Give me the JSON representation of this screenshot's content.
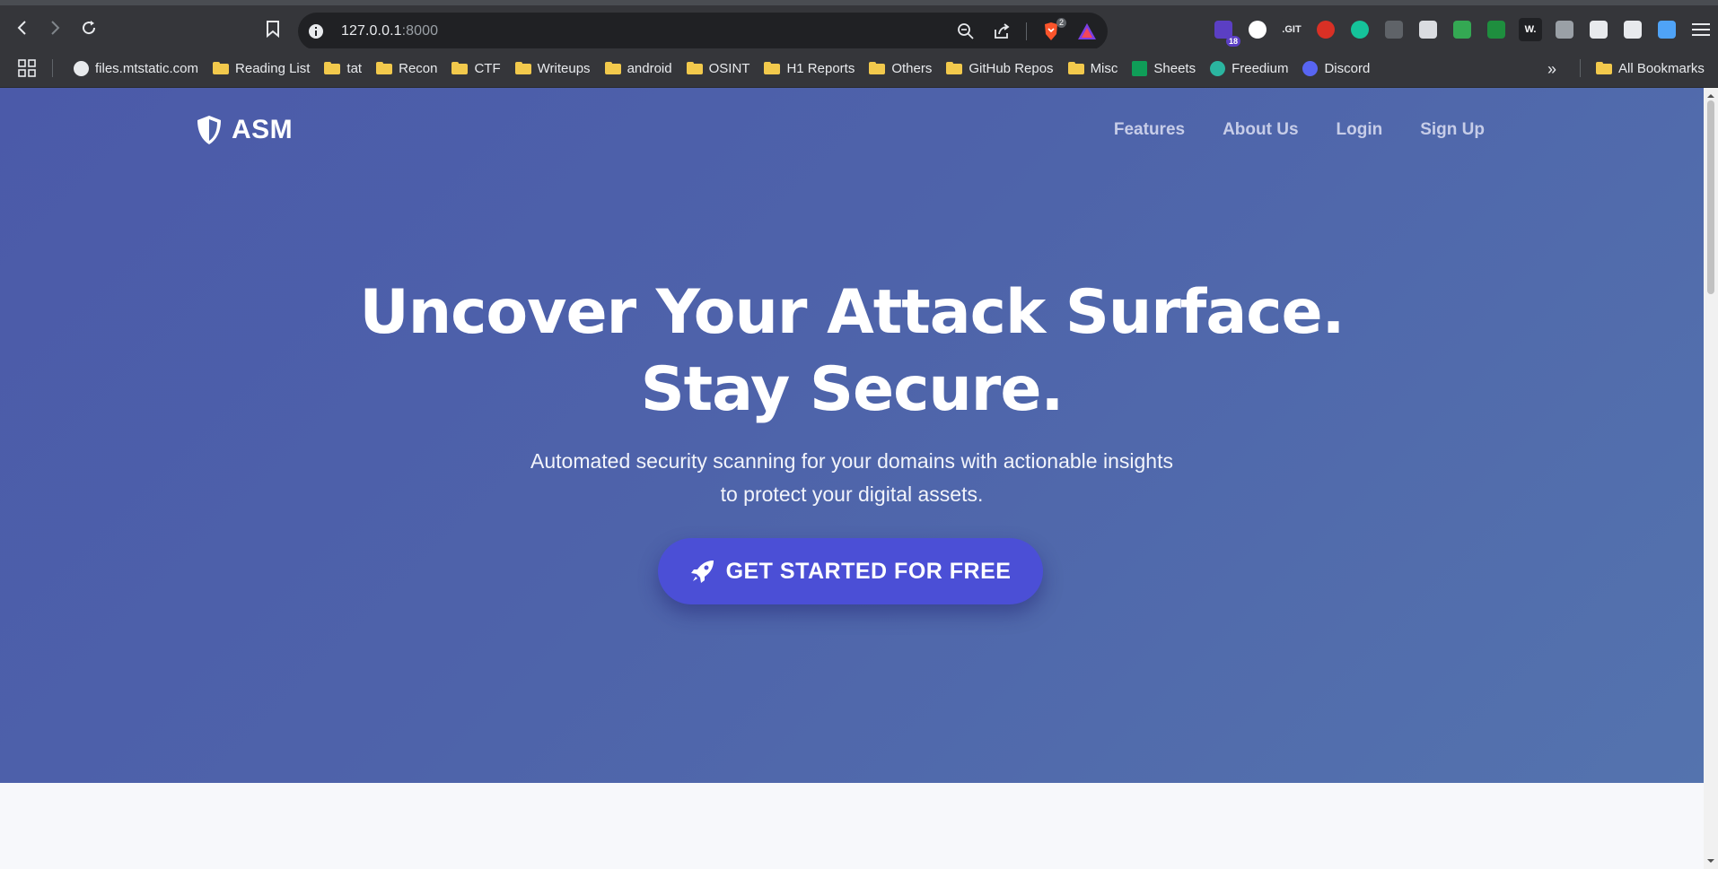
{
  "browser": {
    "url_host": "127.0.0.1",
    "url_port": ":8000",
    "extensions": [
      {
        "name": "hat-extension-icon",
        "badge": "18",
        "color": "#5b3fc4"
      },
      {
        "name": "pattern-extension-icon",
        "badge": "",
        "color": "#ffffff"
      },
      {
        "name": "git-extension-icon",
        "badge": "",
        "color": "#35363a",
        "label": ".GIT"
      },
      {
        "name": "drop-extension-icon",
        "badge": "",
        "color": "#d93025"
      },
      {
        "name": "grammarly-extension-icon",
        "badge": "",
        "color": "#15c39a"
      },
      {
        "name": "copy-extension-icon",
        "badge": "",
        "color": "#5f6368"
      },
      {
        "name": "printer-extension-icon",
        "badge": "",
        "color": "#dadce0"
      },
      {
        "name": "robot-extension-icon",
        "badge": "",
        "color": "#34a853"
      },
      {
        "name": "mail-extension-icon",
        "badge": "",
        "color": "#1e8e3e"
      },
      {
        "name": "wappalyzer-extension-icon",
        "badge": "",
        "color": "#202124",
        "label": "W."
      },
      {
        "name": "camera-extension-icon",
        "badge": "",
        "color": "#9aa0a6"
      },
      {
        "name": "puzzle-extension-icon",
        "badge": "",
        "color": "#e8eaed"
      },
      {
        "name": "sparkle-extension-icon",
        "badge": "",
        "color": "#e8eaed"
      },
      {
        "name": "k-extension-icon",
        "badge": "",
        "color": "#4fa3f7"
      },
      {
        "name": "menu-icon",
        "badge": "",
        "color": "#e8eaed"
      }
    ]
  },
  "bookmarks": [
    {
      "label": "files.mtstatic.com",
      "icon": "globe-icon"
    },
    {
      "label": "Reading List",
      "icon": "folder-icon"
    },
    {
      "label": "tat",
      "icon": "folder-icon"
    },
    {
      "label": "Recon",
      "icon": "folder-icon"
    },
    {
      "label": "CTF",
      "icon": "folder-icon"
    },
    {
      "label": "Writeups",
      "icon": "folder-icon"
    },
    {
      "label": "android",
      "icon": "folder-icon"
    },
    {
      "label": "OSINT",
      "icon": "folder-icon"
    },
    {
      "label": "H1 Reports",
      "icon": "folder-icon"
    },
    {
      "label": "Others",
      "icon": "folder-icon"
    },
    {
      "label": "GitHub Repos",
      "icon": "folder-icon"
    },
    {
      "label": "Misc",
      "icon": "folder-icon"
    },
    {
      "label": "Sheets",
      "icon": "sheets-icon"
    },
    {
      "label": "Freedium",
      "icon": "freedium-icon"
    },
    {
      "label": "Discord",
      "icon": "discord-icon"
    }
  ],
  "bookmarks_all": "All Bookmarks",
  "site": {
    "logo": "ASM",
    "nav": [
      "Features",
      "About Us",
      "Login",
      "Sign Up"
    ],
    "hero_line1": "Uncover Your Attack Surface.",
    "hero_line2": "Stay Secure.",
    "subtitle_line1": "Automated security scanning for your domains with actionable insights",
    "subtitle_line2": "to protect your digital assets.",
    "cta": "GET STARTED FOR FREE"
  },
  "colors": {
    "hero_gradient_start": "#4b5aa9",
    "hero_gradient_end": "#5473ae",
    "cta_background": "#4b4fd6",
    "nav_link": "#c7cde8"
  }
}
